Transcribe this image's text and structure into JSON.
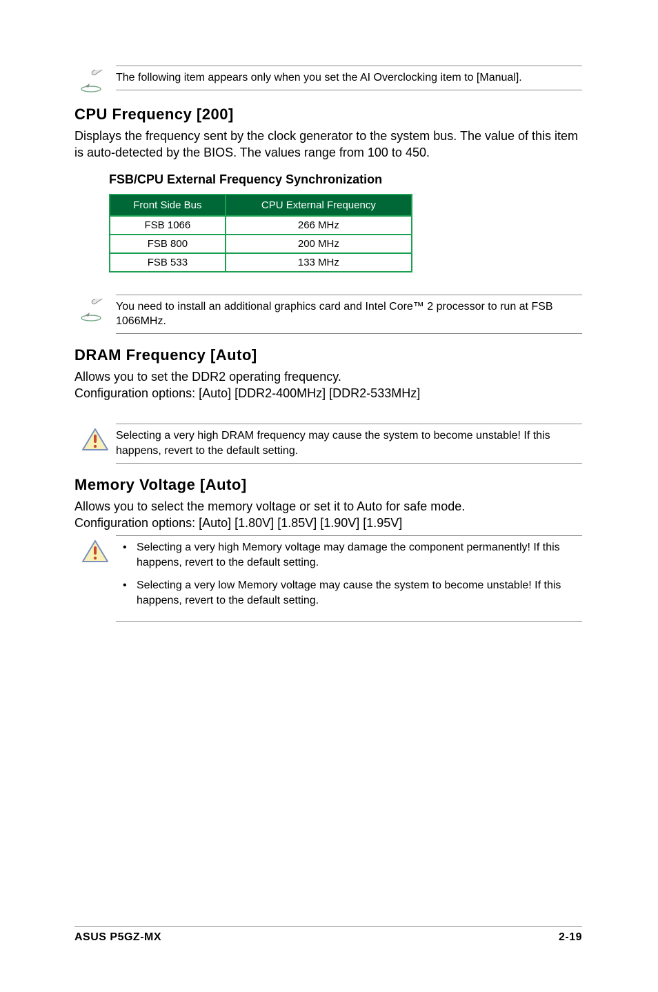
{
  "note1": {
    "text": "The following item appears only when you set the AI Overclocking item to [Manual]."
  },
  "section_cpu": {
    "heading": "CPU Frequency [200]",
    "body": "Displays the frequency sent by the clock generator to the system bus. The value of this item is auto-detected by the BIOS. The values range from 100 to 450."
  },
  "fsb_sync": {
    "heading": "FSB/CPU External Frequency Synchronization",
    "th1": "Front Side Bus",
    "th2": "CPU External Frequency",
    "rows": [
      {
        "c1": "FSB 1066",
        "c2": "266 MHz"
      },
      {
        "c1": "FSB 800",
        "c2": "200 MHz"
      },
      {
        "c1": "FSB 533",
        "c2": "133 MHz"
      }
    ]
  },
  "note2": {
    "text": "You need to install an additional graphics card and Intel Core™ 2 processor to run at FSB 1066MHz."
  },
  "section_dram": {
    "heading": "DRAM Frequency [Auto]",
    "body1": "Allows you to set the DDR2 operating frequency.",
    "body2": "Configuration options: [Auto] [DDR2-400MHz] [DDR2-533MHz]"
  },
  "warning1": {
    "text": "Selecting a very high DRAM frequency may cause the system to become unstable! If this happens, revert to the default setting."
  },
  "section_mem": {
    "heading": "Memory Voltage [Auto]",
    "body1": "Allows you to select the memory voltage or set it to Auto for safe mode.",
    "body2": "Configuration options: [Auto] [1.80V] [1.85V] [1.90V] [1.95V]"
  },
  "warning2": {
    "item1": "Selecting a very high Memory voltage may damage the component permanently! If this happens, revert to the default setting.",
    "item2": "Selecting a very low Memory voltage may cause the system to become unstable!  If this happens, revert to the default setting."
  },
  "footer": {
    "left": "ASUS P5GZ-MX",
    "right": "2-19"
  }
}
